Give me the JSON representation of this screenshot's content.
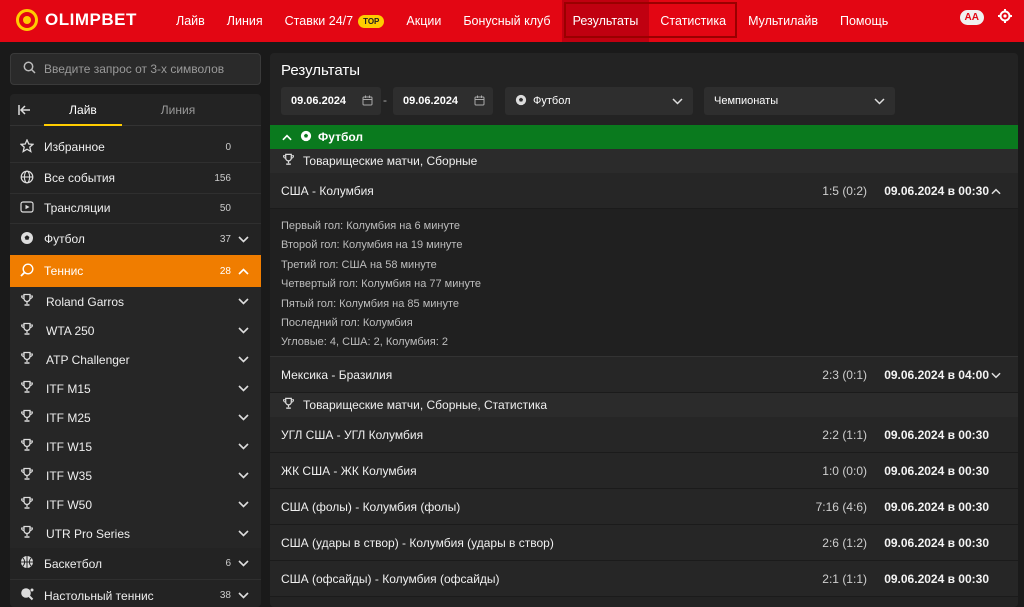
{
  "header": {
    "logo_text": "OLIMPBET",
    "nav": [
      {
        "label": "Лайв"
      },
      {
        "label": "Линия"
      },
      {
        "label": "Ставки 24/7",
        "badge": "TOP"
      },
      {
        "label": "Акции"
      },
      {
        "label": "Бонусный клуб"
      },
      {
        "label": "Результаты"
      },
      {
        "label": "Статистика"
      },
      {
        "label": "Мультилайв"
      },
      {
        "label": "Помощь"
      }
    ],
    "font_toggle": "AA",
    "accent_color": "#e30613"
  },
  "sidebar": {
    "search_placeholder": "Введите запрос от 3-х символов",
    "tabs": [
      {
        "label": "Лайв"
      },
      {
        "label": "Линия"
      }
    ],
    "items": [
      {
        "label": "Избранное",
        "count": "0",
        "icon": "star-icon"
      },
      {
        "label": "Все события",
        "count": "156",
        "icon": "globe-icon"
      },
      {
        "label": "Трансляции",
        "count": "50",
        "icon": "play-icon"
      },
      {
        "label": "Футбол",
        "count": "37",
        "icon": "soccer-ball-icon"
      },
      {
        "label": "Теннис",
        "count": "28",
        "icon": "tennis-icon"
      },
      {
        "label": "Roland Garros",
        "icon": "trophy-icon"
      },
      {
        "label": "WTA 250",
        "icon": "trophy-icon"
      },
      {
        "label": "ATP Challenger",
        "icon": "trophy-icon"
      },
      {
        "label": "ITF M15",
        "icon": "trophy-icon"
      },
      {
        "label": "ITF M25",
        "icon": "trophy-icon"
      },
      {
        "label": "ITF W15",
        "icon": "trophy-icon"
      },
      {
        "label": "ITF W35",
        "icon": "trophy-icon"
      },
      {
        "label": "ITF W50",
        "icon": "trophy-icon"
      },
      {
        "label": "UTR Pro Series",
        "icon": "trophy-icon"
      },
      {
        "label": "Баскетбол",
        "count": "6",
        "icon": "basketball-icon"
      },
      {
        "label": "Настольный теннис",
        "count": "38",
        "icon": "table-tennis-icon"
      }
    ]
  },
  "main": {
    "title": "Результаты",
    "date_from": "09.06.2024",
    "date_to": "09.06.2024",
    "sport_select": "Футбол",
    "championship_select": "Чемпионаты",
    "sport_header": "Футбол",
    "leagues": [
      {
        "name": "Товарищеские матчи, Сборные",
        "matches": [
          {
            "teams": "США - Колумбия",
            "score": "1:5 (0:2)",
            "datetime": "09.06.2024 в 00:30",
            "details": [
              "Первый гол: Колумбия на 6 минуте",
              "Второй гол: Колумбия на 19 минуте",
              "Третий гол: США на 58 минуте",
              "Четвертый гол: Колумбия на 77 минуте",
              "Пятый гол: Колумбия на 85 минуте",
              "Последний гол: Колумбия",
              "Угловые: 4, США: 2, Колумбия: 2"
            ]
          },
          {
            "teams": "Мексика - Бразилия",
            "score": "2:3 (0:1)",
            "datetime": "09.06.2024 в 04:00"
          }
        ]
      },
      {
        "name": "Товарищеские матчи, Сборные, Статистика",
        "matches": [
          {
            "teams": "УГЛ США - УГЛ Колумбия",
            "score": "2:2 (1:1)",
            "datetime": "09.06.2024 в 00:30"
          },
          {
            "teams": "ЖК США - ЖК Колумбия",
            "score": "1:0 (0:0)",
            "datetime": "09.06.2024 в 00:30"
          },
          {
            "teams": "США (фолы) - Колумбия (фолы)",
            "score": "7:16 (4:6)",
            "datetime": "09.06.2024 в 00:30"
          },
          {
            "teams": "США (удары в створ) - Колумбия (удары в створ)",
            "score": "2:6 (1:2)",
            "datetime": "09.06.2024 в 00:30"
          },
          {
            "teams": "США (офсайды) - Колумбия (офсайды)",
            "score": "2:1 (1:1)",
            "datetime": "09.06.2024 в 00:30"
          }
        ]
      }
    ]
  }
}
